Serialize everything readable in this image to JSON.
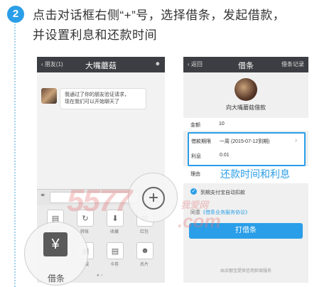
{
  "step": {
    "number": "2",
    "line1": "点击对话框右侧“+”号，选择借条，发起借款，",
    "line2": "并设置利息和还款时间"
  },
  "chat": {
    "back_label": "朋友(1)",
    "title": "大嘴蘑菇",
    "message_line1": "我通过了你的朋友验证请求，",
    "message_line2": "现在我们可以开始聊天了",
    "plus_symbol": "+",
    "panel_labels": [
      "图片",
      "转账",
      "收藏",
      "红包",
      "借条",
      "商城",
      "卡券",
      "名片"
    ],
    "highlight_label": "借条"
  },
  "loan": {
    "back_label": "返回",
    "title": "借条",
    "right_label": "借条记录",
    "subtitle": "向大嘴蘑菇借款",
    "amount_label": "金额",
    "amount_value": "10",
    "period_label": "借款期限",
    "period_value": "一周 (2015-07-12到期)",
    "interest_label": "利息",
    "interest_value": "0.01",
    "reason_label": "理由",
    "annotation": "还款时间和利息",
    "checkbox_label": "到期支付宝自动扣款",
    "agree_prefix": "同意",
    "agree_link": "《借条业务服务协议》",
    "submit_label": "打借条",
    "footer": "由余额宝提供信用担保服务"
  },
  "watermark": {
    "digits": "5577",
    "text": ".com",
    "brand": "我爱网"
  },
  "colors": {
    "accent": "#2a9ee8",
    "navbar": "#3c3e43",
    "submit": "#2a9ee8"
  }
}
